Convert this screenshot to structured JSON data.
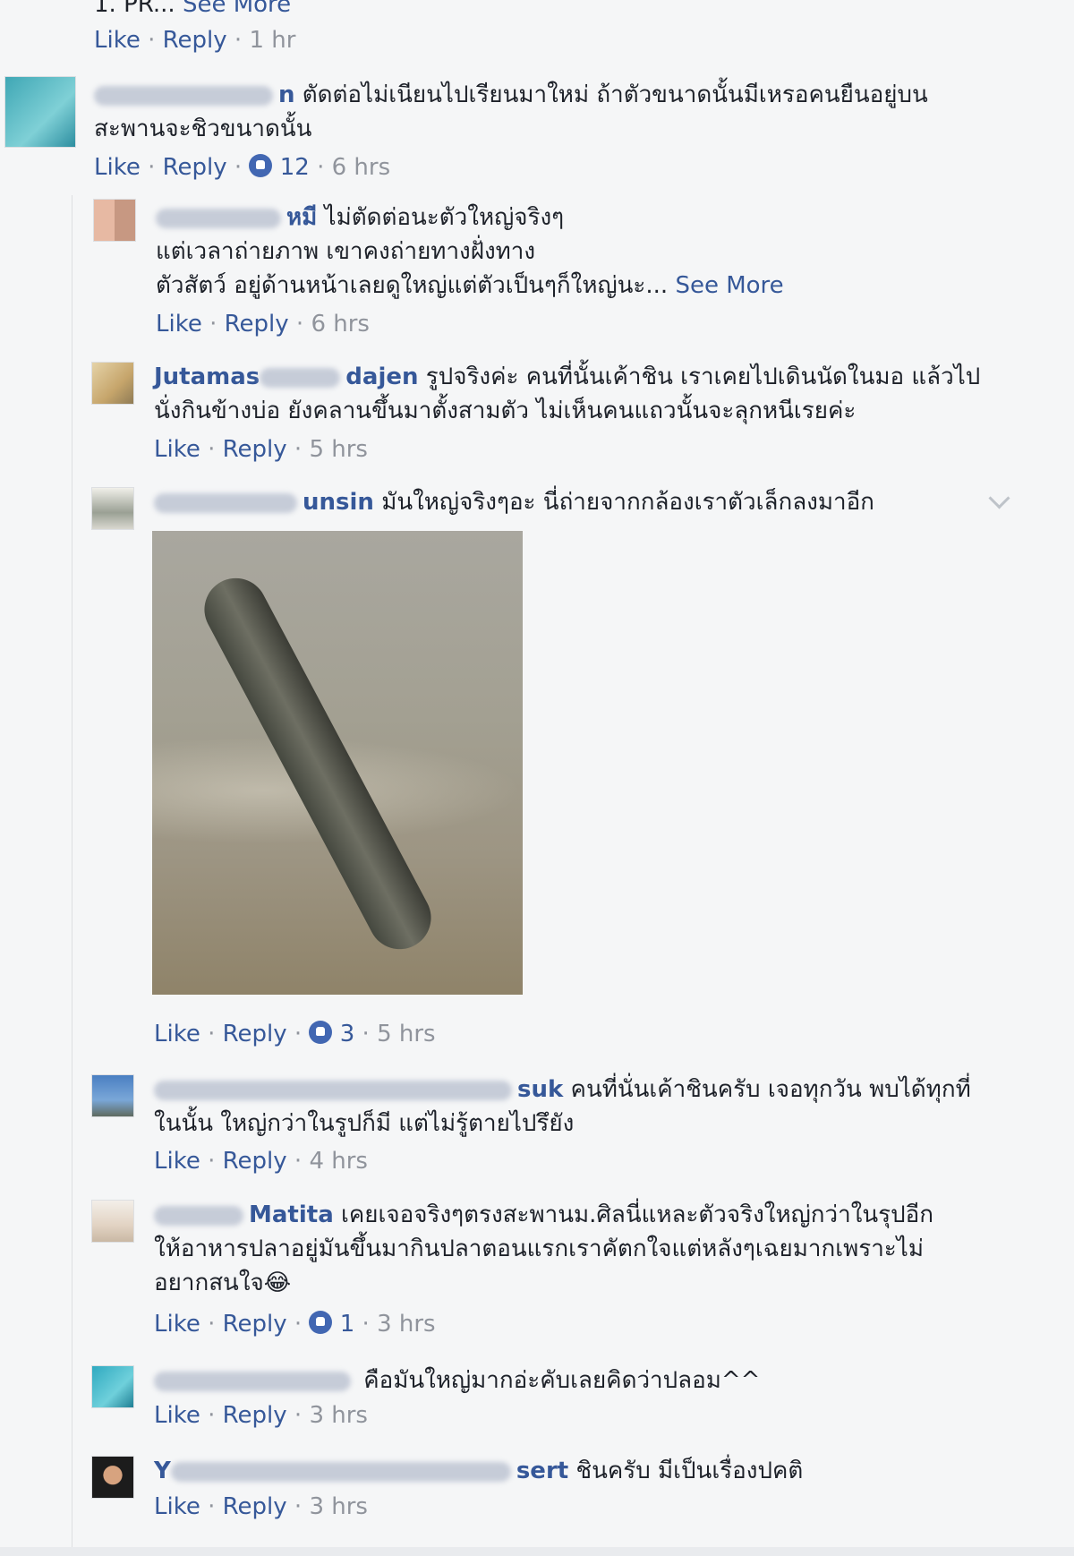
{
  "comments": {
    "c0": {
      "text_tail": "1. PR...",
      "see_more": "See More",
      "like": "Like",
      "reply": "Reply",
      "time": "1 hr"
    },
    "c1": {
      "name_tail": "n",
      "line1": "ตัดต่อไม่เนียนไปเรียนมาใหม่ ถ้าตัวขนาดนั้นมีเหรอคนยืนอยู่บน",
      "line2": "สะพานจะชิวขนาดนั้น",
      "like": "Like",
      "reply": "Reply",
      "reactions": "12",
      "time": "6 hrs"
    },
    "c2": {
      "name_tail": "หมี",
      "line1": "ไม่ตัดต่อนะตัวใหญ่จริงๆ",
      "line2": "แต่เวลาถ่ายภาพ เขาคงถ่ายทางฝั่งทาง",
      "line3": "ตัวสัตว์ อยู่ด้านหน้าเลยดูใหญ่แต่ตัวเป็นๆก็ใหญ่นะ...",
      "see_more": "See More",
      "like": "Like",
      "reply": "Reply",
      "time": "6 hrs"
    },
    "c3": {
      "name_head": "Jutamas",
      "name_tail": "dajen",
      "line1": "รูปจริงค่ะ คนที่นั้นเค้าชิน เราเคยไปเดินนัดในมอ แล้วไป",
      "line2": "นั่งกินข้างบ่อ ยังคลานขึ้นมาตั้งสามตัว ไม่เห็นคนแถวนั้นจะลุกหนีเรยค่ะ",
      "like": "Like",
      "reply": "Reply",
      "time": "5 hrs"
    },
    "c4": {
      "name_tail": "unsin",
      "line1": "มันใหญ่จริงๆอะ นี่ถ่ายจากกล้องเราตัวเล็กลงมาอีก",
      "like": "Like",
      "reply": "Reply",
      "reactions": "3",
      "time": "5 hrs"
    },
    "c5": {
      "name_tail": "suk",
      "line1": "คนที่นั่นเค้าชินครับ เจอทุกวัน พบได้ทุกที่",
      "line2": "ในนั้น ใหญ่กว่าในรูปก็มี แต่ไม่รู้ตายไปรึยัง",
      "like": "Like",
      "reply": "Reply",
      "time": "4 hrs"
    },
    "c6": {
      "name_tail": "Matita",
      "line1": "เคยเจอจริงๆตรงสะพานม.ศิลนี่แหละตัวจริงใหญ่กว่าในรุปอีก",
      "line2": "ให้อาหารปลาอยู่มันขึ้นมากินปลาตอนแรกเราคัตกใจแต่หลังๆเฉยมากเพราะไม่",
      "line3": "อยากสนใจ",
      "emoji": "😂",
      "like": "Like",
      "reply": "Reply",
      "reactions": "1",
      "time": "3 hrs"
    },
    "c7": {
      "line1": "คือมันใหญ่มากอ่ะคับเลยคิดว่าปลอม^^",
      "like": "Like",
      "reply": "Reply",
      "time": "3 hrs"
    },
    "c8": {
      "name_head": "Y",
      "name_tail": "sert",
      "line1": "ชินครับ มีเป็นเรื่องปคติ",
      "like": "Like",
      "reply": "Reply",
      "time": "3 hrs"
    }
  },
  "separator": "·",
  "colors": {
    "link": "#365899",
    "meta": "#90949c",
    "background": "#f5f6f7",
    "like_badge": "#4267b2"
  },
  "icons": {
    "reaction": "like-reaction-icon",
    "menu": "chevron-down-icon"
  }
}
